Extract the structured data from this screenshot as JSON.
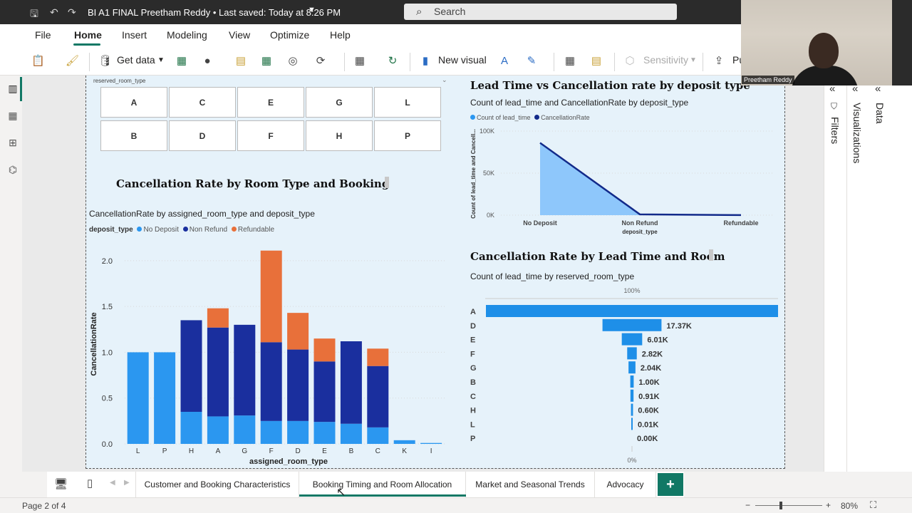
{
  "titlebar": {
    "doc_title": "BI A1 FINAL Preetham Reddy • Last saved: Today at 8:26 PM",
    "search_placeholder": "Search"
  },
  "menu": {
    "items": [
      "File",
      "Home",
      "Insert",
      "Modeling",
      "View",
      "Optimize",
      "Help"
    ],
    "active": "Home"
  },
  "ribbon": {
    "get_data": "Get data",
    "new_visual": "New visual",
    "sensitivity": "Sensitivity",
    "publish_partial": "Pu"
  },
  "slicer": {
    "field": "reserved_room_type",
    "row1": [
      "A",
      "C",
      "E",
      "G",
      "L"
    ],
    "row2": [
      "B",
      "D",
      "F",
      "H",
      "P"
    ]
  },
  "visual_bar": {
    "title": "Cancellation Rate by Room Type and Booking",
    "subtitle": "CancellationRate by assigned_room_type and deposit_type",
    "legend_title": "deposit_type",
    "legend": [
      {
        "name": "No Deposit",
        "color": "#2b97f0"
      },
      {
        "name": "Non Refund",
        "color": "#1a2f9e"
      },
      {
        "name": "Refundable",
        "color": "#e8703a"
      }
    ],
    "xlabel": "assigned_room_type",
    "ylabel": "CancellationRate"
  },
  "visual_area": {
    "title": "Lead Time vs Cancellation rate by deposit type",
    "subtitle": "Count of lead_time and CancellationRate by deposit_type",
    "legend": [
      {
        "name": "Count of lead_time",
        "color": "#2b97f0"
      },
      {
        "name": "CancellationRate",
        "color": "#122a8a"
      }
    ],
    "ylabel": "Count of lead_time and Cancell...",
    "xlabel": "deposit_type"
  },
  "visual_funnel": {
    "title": "Cancellation Rate by Lead Time and Room",
    "subtitle": "Count of lead_time by reserved_room_type",
    "top_label": "100%",
    "bottom_label": "0%"
  },
  "panes": {
    "filters": "Filters",
    "visualizations": "Visualizations",
    "data": "Data"
  },
  "webcam": {
    "name": "Preetham Reddy"
  },
  "tabs": [
    "Customer and Booking Characteristics",
    "Booking Timing and Room Allocation",
    "Market and Seasonal Trends",
    "Advocacy"
  ],
  "active_tab": "Booking Timing and Room Allocation",
  "status": {
    "page": "Page 2 of 4",
    "zoom": "80%"
  },
  "chart_data": [
    {
      "type": "bar",
      "stacked": true,
      "categories": [
        "L",
        "P",
        "H",
        "A",
        "G",
        "F",
        "D",
        "E",
        "B",
        "C",
        "K",
        "I"
      ],
      "series": [
        {
          "name": "No Deposit",
          "values": [
            1.0,
            1.0,
            0.35,
            0.3,
            0.31,
            0.25,
            0.25,
            0.24,
            0.22,
            0.18,
            0.04,
            0.01
          ]
        },
        {
          "name": "Non Refund",
          "values": [
            0,
            0,
            1.0,
            0.97,
            0.99,
            0.86,
            0.78,
            0.66,
            0.9,
            0.67,
            0,
            0
          ]
        },
        {
          "name": "Refundable",
          "values": [
            0,
            0,
            0,
            0.21,
            0,
            1.0,
            0.4,
            0.25,
            0,
            0.19,
            0,
            0
          ]
        }
      ],
      "ylim": [
        0,
        2.1
      ],
      "yticks": [
        "0.0",
        "0.5",
        "1.0",
        "1.5",
        "2.0"
      ],
      "xlabel": "assigned_room_type",
      "ylabel": "CancellationRate"
    },
    {
      "type": "area",
      "categories": [
        "No Deposit",
        "Non Refund",
        "Refundable"
      ],
      "series": [
        {
          "name": "Count of lead_time",
          "values": [
            86000,
            1000,
            100
          ]
        },
        {
          "name": "CancellationRate",
          "values": [
            86000,
            1000,
            100
          ]
        }
      ],
      "ylim": [
        0,
        100000
      ],
      "yticks": [
        "0K",
        "50K",
        "100K"
      ],
      "xlabel": "deposit_type"
    },
    {
      "type": "bar",
      "orientation": "funnel",
      "categories": [
        "A",
        "D",
        "E",
        "F",
        "G",
        "B",
        "C",
        "H",
        "L",
        "P"
      ],
      "values": [
        85994,
        17370,
        6010,
        2820,
        2040,
        1000,
        910,
        600,
        10,
        0
      ],
      "labels": [
        "",
        "17.37K",
        "6.01K",
        "2.82K",
        "2.04K",
        "1.00K",
        "0.91K",
        "0.60K",
        "0.01K",
        "0.00K"
      ]
    }
  ]
}
